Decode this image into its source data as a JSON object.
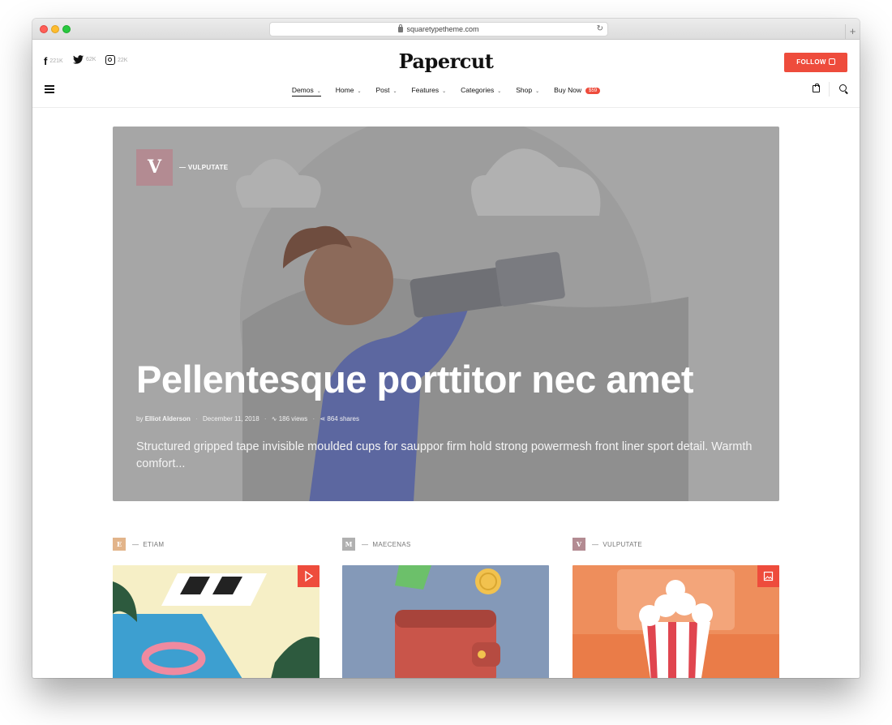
{
  "browser": {
    "url": "squaretypetheme.com"
  },
  "header": {
    "social": [
      {
        "icon": "facebook-icon",
        "count": "221K"
      },
      {
        "icon": "twitter-icon",
        "count": "62K"
      },
      {
        "icon": "instagram-icon",
        "count": "22K"
      }
    ],
    "logo": "Papercut",
    "follow_label": "FOLLOW"
  },
  "nav": {
    "items": [
      {
        "label": "Demos",
        "active": true
      },
      {
        "label": "Home"
      },
      {
        "label": "Post"
      },
      {
        "label": "Features"
      },
      {
        "label": "Categories"
      },
      {
        "label": "Shop"
      },
      {
        "label": "Buy Now",
        "badge": "$59"
      }
    ]
  },
  "hero": {
    "category_letter": "V",
    "category": "VULPUTATE",
    "title": "Pellentesque porttitor nec amet",
    "by": "by",
    "author": "Elliot Alderson",
    "date": "December 11, 2018",
    "views": "186 views",
    "shares": "864 shares",
    "excerpt": "Structured gripped tape invisible moulded cups for sauppor firm hold strong powermesh front liner sport detail. Warmth comfort..."
  },
  "cards": [
    {
      "letter": "E",
      "category": "ETIAM",
      "badge_color": "#e2b48a"
    },
    {
      "letter": "M",
      "category": "MAECENAS",
      "badge_color": "#b0b0b0"
    },
    {
      "letter": "V",
      "category": "VULPUTATE",
      "badge_color": "#b38b92"
    }
  ],
  "colors": {
    "accent": "#ee4c3c",
    "hero_bg": "#a6a6a6"
  }
}
